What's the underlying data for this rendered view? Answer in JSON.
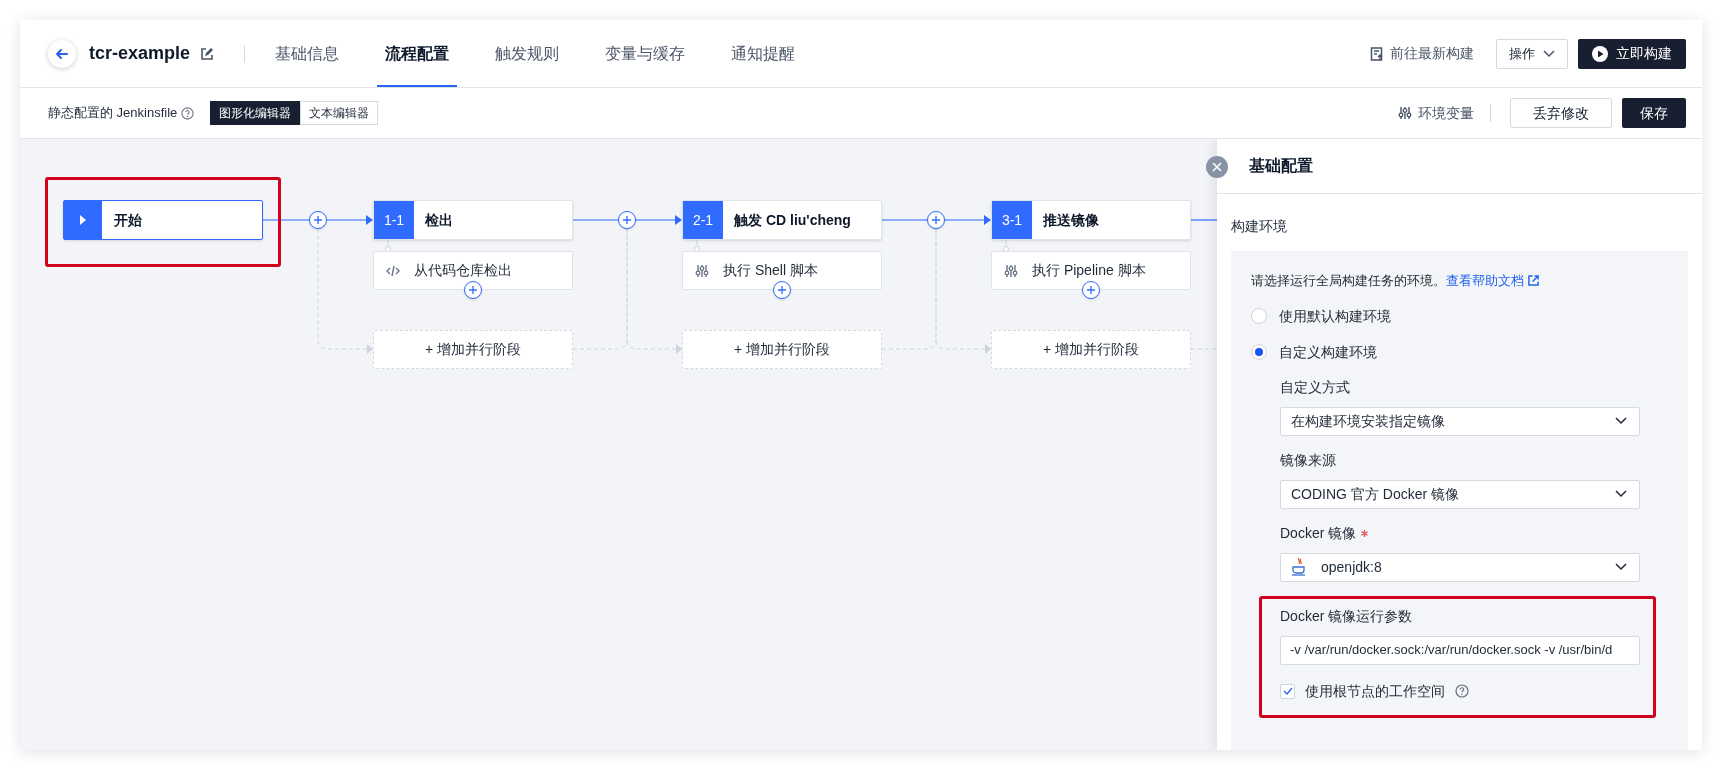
{
  "header": {
    "project_name": "tcr-example",
    "tabs": [
      {
        "label": "基础信息",
        "selected": false
      },
      {
        "label": "流程配置",
        "selected": true
      },
      {
        "label": "触发规则",
        "selected": false
      },
      {
        "label": "变量与缓存",
        "selected": false
      },
      {
        "label": "通知提醒",
        "selected": false
      }
    ],
    "latest_build_link": "前往最新构建",
    "ops_button": "操作",
    "build_button": "立即构建"
  },
  "toolbar": {
    "title": "静态配置的 Jenkinsfile",
    "editor_modes": [
      {
        "label": "图形化编辑器",
        "selected": true
      },
      {
        "label": "文本编辑器",
        "selected": false
      }
    ],
    "env_vars": "环境变量",
    "discard_button": "丢弃修改",
    "save_button": "保存"
  },
  "pipeline": {
    "start": {
      "label": "开始",
      "highlighted": true
    },
    "stages": [
      {
        "index": "1-1",
        "name": "检出",
        "steps": [
          {
            "kind": "code",
            "label": "从代码仓库检出"
          }
        ],
        "add_parallel": "+ 增加并行阶段"
      },
      {
        "index": "2-1",
        "name": "触发 CD liu'cheng",
        "steps": [
          {
            "kind": "script",
            "label": "执行 Shell 脚本"
          }
        ],
        "add_parallel": "+ 增加并行阶段"
      },
      {
        "index": "3-1",
        "name": "推送镜像",
        "steps": [
          {
            "kind": "script",
            "label": "执行 Pipeline 脚本"
          }
        ],
        "add_parallel": "+ 增加并行阶段"
      }
    ]
  },
  "panel": {
    "title": "基础配置",
    "section": "构建环境",
    "intro": "请选择运行全局构建任务的环境。",
    "help_link": "查看帮助文档",
    "env_options": [
      {
        "label": "使用默认构建环境",
        "selected": false
      },
      {
        "label": "自定义构建环境",
        "selected": true
      }
    ],
    "fields": [
      {
        "label": "自定义方式",
        "value": "在构建环境安装指定镜像"
      },
      {
        "label": "镜像来源",
        "value": "CODING 官方 Docker 镜像"
      },
      {
        "label": "Docker 镜像",
        "value": "openjdk:8",
        "required": true,
        "image_icon": true
      }
    ],
    "runtime": {
      "highlighted": true,
      "label": "Docker 镜像运行参数",
      "value": "-v /var/run/docker.sock:/var/run/docker.sock -v /usr/bin/d",
      "checkbox": {
        "label": "使用根节点的工作空间",
        "checked": true
      }
    }
  }
}
